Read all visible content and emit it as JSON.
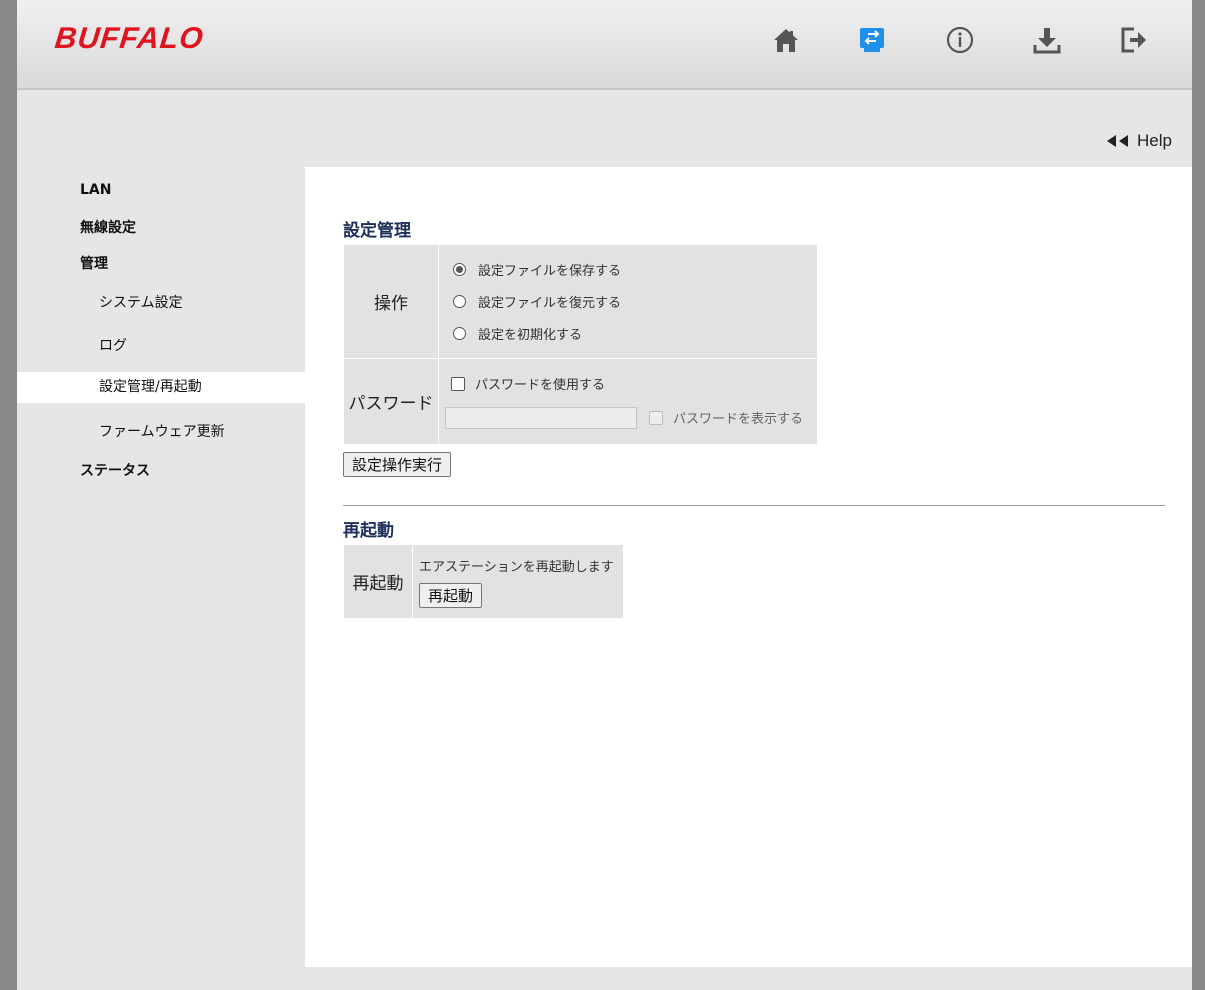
{
  "header": {
    "logo": "BUFFALO",
    "icons": [
      "home-icon",
      "settings-icon",
      "info-icon",
      "download-icon",
      "logout-icon"
    ],
    "active_icon": "settings-icon",
    "active_color": "#1e90e8"
  },
  "help": {
    "label": "Help"
  },
  "sidebar": {
    "items": [
      {
        "label": "LAN",
        "level": "top"
      },
      {
        "label": "無線設定",
        "level": "top"
      },
      {
        "label": "管理",
        "level": "top"
      },
      {
        "label": "システム設定",
        "level": "sub"
      },
      {
        "label": "ログ",
        "level": "sub"
      },
      {
        "label": "設定管理/再起動",
        "level": "sub",
        "active": true
      },
      {
        "label": "ファームウェア更新",
        "level": "sub"
      },
      {
        "label": "ステータス",
        "level": "top"
      }
    ]
  },
  "settings": {
    "title": "設定管理",
    "operation": {
      "header": "操作",
      "options": [
        {
          "label": "設定ファイルを保存する",
          "checked": true
        },
        {
          "label": "設定ファイルを復元する",
          "checked": false
        },
        {
          "label": "設定を初期化する",
          "checked": false
        }
      ]
    },
    "password": {
      "header": "パスワード",
      "use_label": "パスワードを使用する",
      "input_value": "",
      "show_label": "パスワードを表示する"
    },
    "execute_button": "設定操作実行"
  },
  "reboot": {
    "title": "再起動",
    "header": "再起動",
    "description": "エアステーションを再起動します",
    "button": "再起動"
  }
}
